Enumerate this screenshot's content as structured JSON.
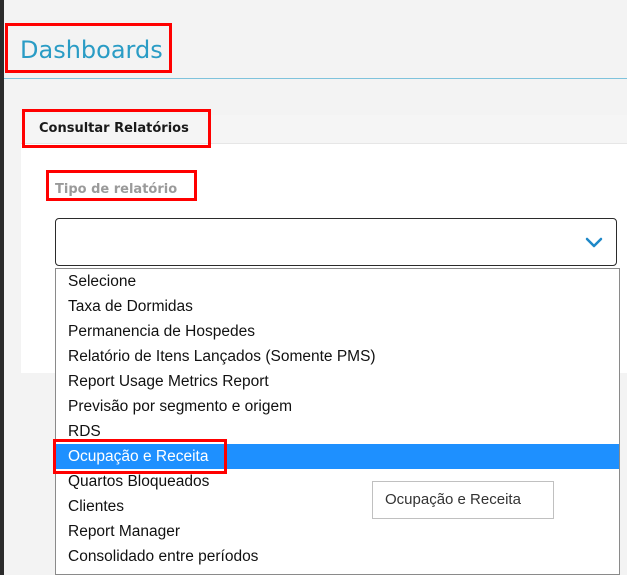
{
  "page": {
    "title": "Dashboards"
  },
  "panel": {
    "title": "Consultar Relatórios"
  },
  "field": {
    "label": "Tipo de relatório",
    "value": ""
  },
  "dropdown": {
    "options": [
      "Selecione",
      "Taxa de Dormidas",
      "Permanencia de Hospedes",
      "Relatório de Itens Lançados (Somente PMS)",
      "Report Usage Metrics Report",
      "Previsão por segmento e origem",
      "RDS",
      "Ocupação e Receita",
      "Quartos Bloqueados",
      "Clientes",
      "Report Manager",
      "Consolidado entre períodos"
    ],
    "highlighted": "Ocupação e Receita"
  },
  "tooltip": {
    "text": "Ocupação e Receita"
  },
  "colors": {
    "accent": "#2a9cc5",
    "selection": "#1e90ff",
    "annotation": "#ff0000"
  }
}
